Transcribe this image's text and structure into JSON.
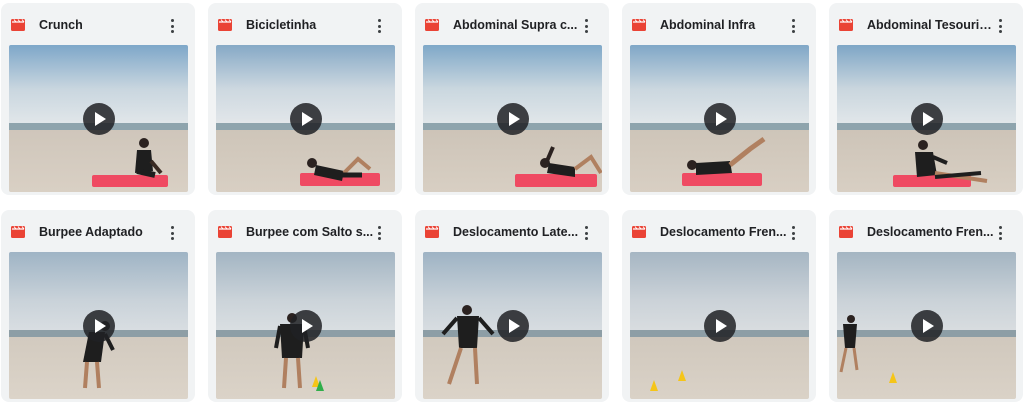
{
  "videos": [
    {
      "title": "Crunch"
    },
    {
      "title": "Bicicletinha"
    },
    {
      "title": "Abdominal Supra c..."
    },
    {
      "title": "Abdominal Infra"
    },
    {
      "title": "Abdominal Tesourin..."
    },
    {
      "title": "Burpee Adaptado"
    },
    {
      "title": "Burpee com Salto s..."
    },
    {
      "title": "Deslocamento Late..."
    },
    {
      "title": "Deslocamento Fren..."
    },
    {
      "title": "Deslocamento Fren..."
    }
  ],
  "icons": {
    "file_type": "film-icon",
    "menu": "more-vert-icon",
    "play": "play-icon"
  },
  "colors": {
    "film_icon": "#ea4335",
    "mat": "#ef4a62",
    "cone": "#f5c518",
    "card_bg": "#f1f3f4"
  }
}
